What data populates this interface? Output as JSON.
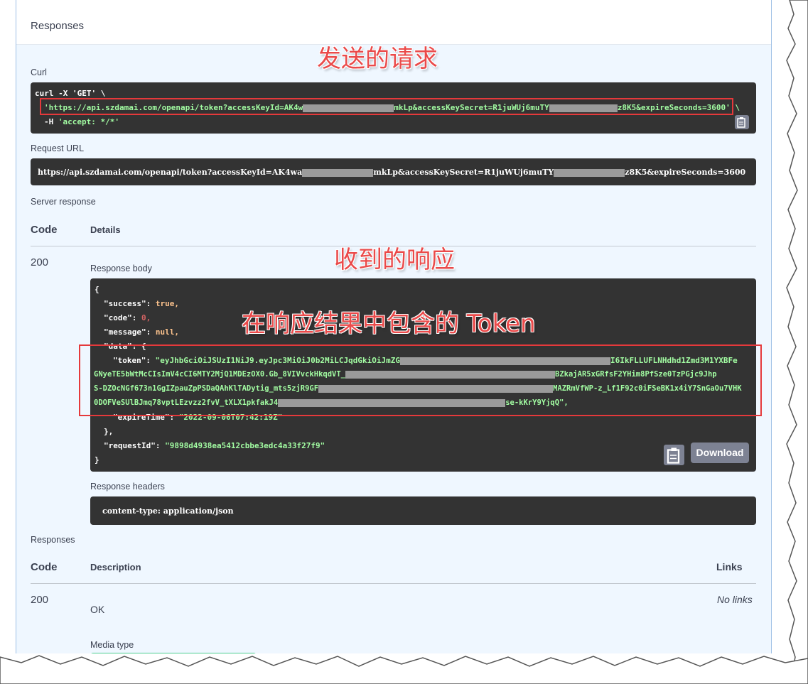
{
  "section_title": "Responses",
  "curl": {
    "label": "Curl",
    "line1": "curl -X 'GET' \\",
    "line2_prefix": "'https://api.szdamai.com/openapi/token?accessKeyId=AK4w",
    "line2_mid": "mkLp&accessKeySecret=R1juWUj6muTY",
    "line2_suffix": "z8K5&expireSeconds=3600' \\",
    "line3_prefix": "-H ",
    "line3_value": "'accept: */*'"
  },
  "request_url": {
    "label": "Request URL",
    "prefix": "https://api.szdamai.com/openapi/token?accessKeyId=AK4wa",
    "mid": "mkLp&accessKeySecret=R1juWUj6muTY",
    "suffix": "z8K5&expireSeconds=3600"
  },
  "server_response": {
    "label": "Server response",
    "col_code": "Code",
    "col_details": "Details",
    "code": "200",
    "body_label": "Response body",
    "json": {
      "open": "{",
      "success_key": "\"success\":",
      "success_val": "true,",
      "code_key": "\"code\":",
      "code_val": "0,",
      "message_key": "\"message\":",
      "message_val": "null,",
      "data_key": "\"data\": {",
      "token_key": "\"token\":",
      "token_l1a": "\"eyJhbGciOiJSUzI1NiJ9.eyJpc3MiOiJ0b2MiLCJqdGkiOiJmZG",
      "token_l1b": "I6IkFLLUFLNHdhd1Zmd3M1YXBFe",
      "token_l2a": "GNyeTE5bWtMcCIsImV4cCI6MTY2MjQ1MDEzOX0.Gb_8VIVvckHkqdVT_",
      "token_l2b": "BZkajAR5xGRfsF2YHim8PfSze0TzPGjc9Jhp",
      "token_l3a": "S-DZOcNGf673n1GgIZpauZpPSDaQAhKlTADytig_mts5zjR9GF",
      "token_l3b": "MAZRmVfWP-z_Lf1F92c0iFSeBK1x4iY7SnGaOu7VHK",
      "token_l4a": "0DOFVeSUlBJmq78vptLEzvzz2fvV_tXLX1pkfakJ4",
      "token_l4b": "se-kKrY9YjqQ\",",
      "expire_key": "\"expireTime\":",
      "expire_val": "\"2022-09-06T07:42:19Z\"",
      "data_close": "},",
      "request_key": "\"requestId\":",
      "request_val": "\"9898d4938ea5412cbbe3edc4a33f27f9\"",
      "close": "}"
    },
    "download_label": "Download",
    "headers_label": "Response headers",
    "header_line": "content-type: application/json"
  },
  "responses": {
    "label": "Responses",
    "col_code": "Code",
    "col_description": "Description",
    "col_links": "Links",
    "code": "200",
    "description": "OK",
    "links": "No links",
    "media_type_label": "Media type"
  },
  "annotations": {
    "sent_request": "发送的请求",
    "received_response": "收到的响应",
    "token_note": "在响应结果中包含的 Token"
  },
  "colors": {
    "annotation_red": "#ea4a4a",
    "highlight_red": "#e5393b",
    "code_green": "#a2fca2",
    "code_orange": "#fcc28c",
    "code_bg": "#333333",
    "panel_bg": "#eff7ff"
  }
}
